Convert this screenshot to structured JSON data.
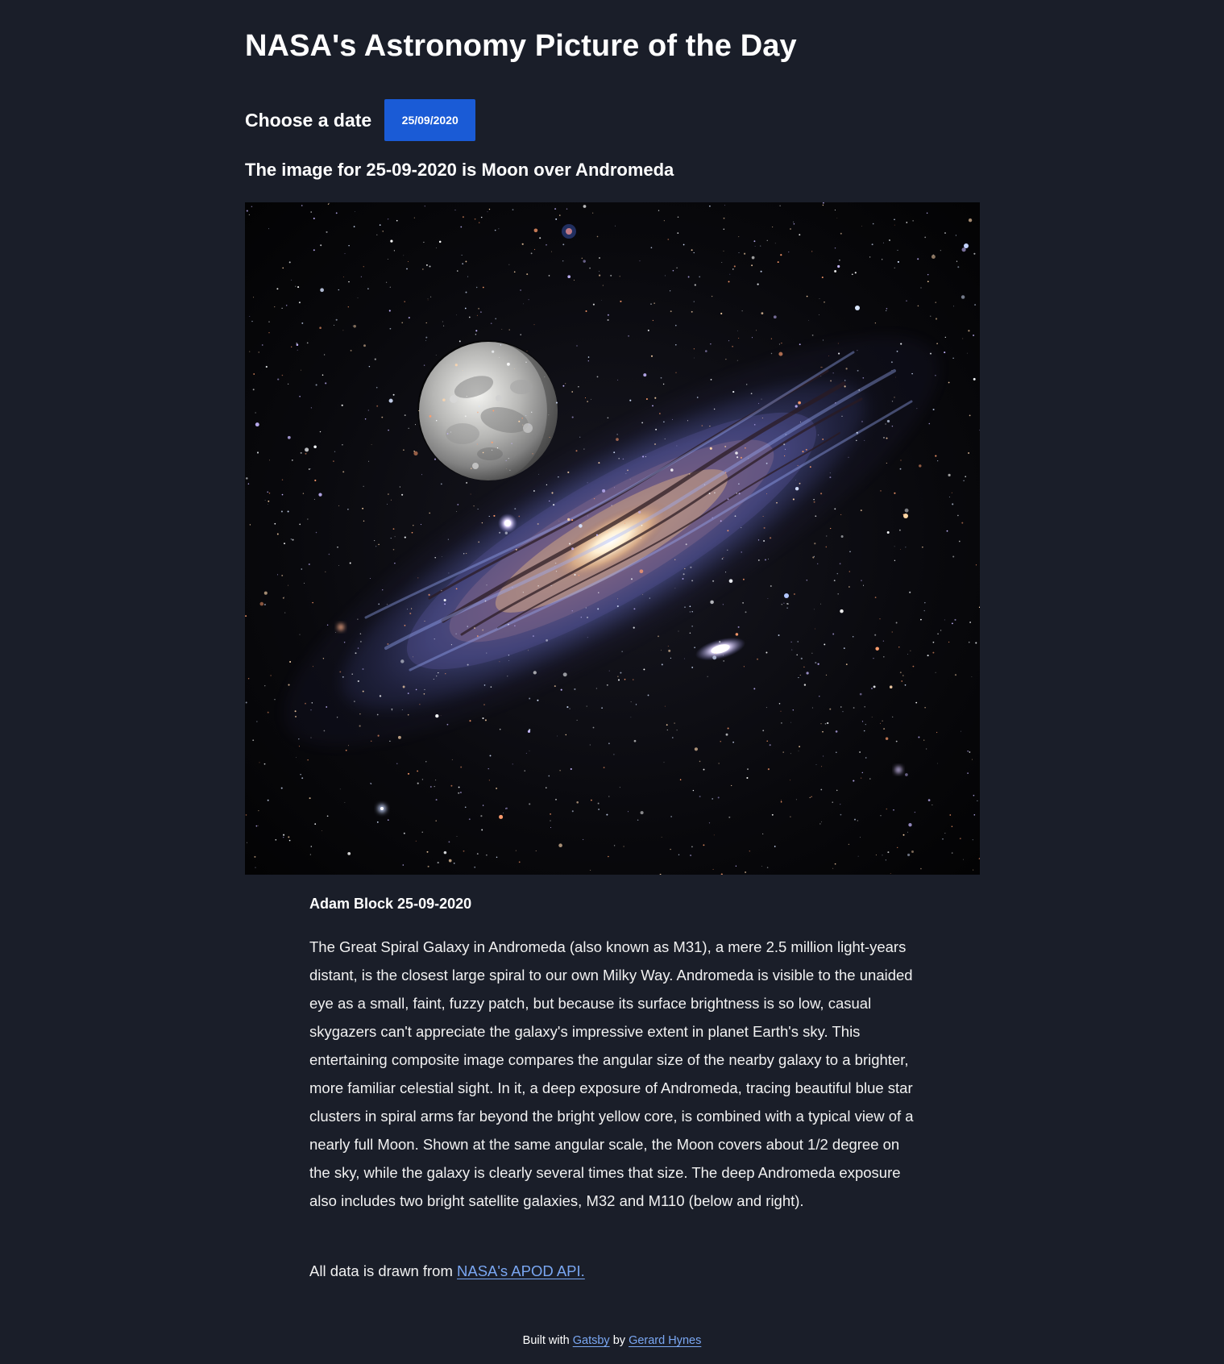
{
  "page": {
    "title": "NASA's Astronomy Picture of the Day"
  },
  "date_picker": {
    "label": "Choose a date",
    "value": "25/09/2020"
  },
  "apod": {
    "subtitle_prefix": "The image for",
    "date": "25-09-2020",
    "subtitle_connector": "is",
    "title": "Moon over Andromeda",
    "credit_author": "Adam Block",
    "credit_date": "25-09-2020",
    "explanation": "The Great Spiral Galaxy in Andromeda (also known as M31), a mere 2.5 million light-years distant, is the closest large spiral to our own Milky Way. Andromeda is visible to the unaided eye as a small, faint, fuzzy patch, but because its surface brightness is so low, casual skygazers can't appreciate the galaxy's impressive extent in planet Earth's sky. This entertaining composite image compares the angular size of the nearby galaxy to a brighter, more familiar celestial sight. In it, a deep exposure of Andromeda, tracing beautiful blue star clusters in spiral arms far beyond the bright yellow core, is combined with a typical view of a nearly full Moon. Shown at the same angular scale, the Moon covers about 1/2 degree on the sky, while the galaxy is clearly several times that size. The deep Andromeda exposure also includes two bright satellite galaxies, M32 and M110 (below and right)."
  },
  "source": {
    "text": "All data is drawn from",
    "link_label": "NASA's APOD API."
  },
  "footer": {
    "built_with": "Built with",
    "framework_link": "Gatsby",
    "by": "by",
    "author_link": "Gerard Hynes"
  },
  "colors": {
    "background": "#1a1e29",
    "button": "#1a5bd6",
    "link": "#7aa7f2"
  }
}
